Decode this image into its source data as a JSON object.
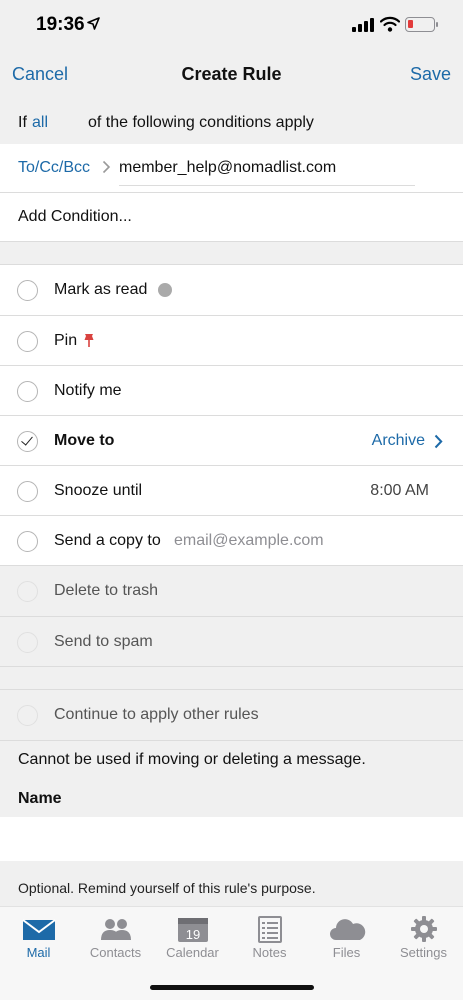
{
  "status_bar": {
    "time": "19:36",
    "icons": [
      "location-arrow-icon",
      "cellular-signal-icon",
      "wifi-icon",
      "battery-low-icon"
    ],
    "battery_color": "#e23b3b"
  },
  "nav": {
    "cancel_label": "Cancel",
    "title": "Create Rule",
    "save_label": "Save"
  },
  "conditions": {
    "prefix": "If",
    "match_mode": "all",
    "suffix": "of the following conditions apply",
    "items": [
      {
        "field": "To/Cc/Bcc",
        "value": "member_help@nomadlist.com"
      }
    ],
    "add_label": "Add Condition..."
  },
  "actions": [
    {
      "label": "Mark as read",
      "checked": false,
      "enabled": true
    },
    {
      "label": "Pin",
      "checked": false,
      "enabled": true
    },
    {
      "label": "Notify me",
      "checked": false,
      "enabled": true
    },
    {
      "label": "Move to",
      "checked": true,
      "enabled": true,
      "value": "Archive"
    },
    {
      "label": "Snooze until",
      "checked": false,
      "enabled": true,
      "value": "8:00 AM"
    },
    {
      "label": "Send a copy to",
      "checked": false,
      "enabled": true,
      "placeholder": "email@example.com"
    },
    {
      "label": "Delete to trash",
      "checked": false,
      "enabled": false
    },
    {
      "label": "Send to spam",
      "checked": false,
      "enabled": false
    }
  ],
  "continue_rule": {
    "label": "Continue to apply other rules",
    "enabled": false,
    "note": "Cannot be used if moving or deleting a message."
  },
  "name_section": {
    "label": "Name",
    "value": "",
    "hint": "Optional. Remind yourself of this rule's purpose."
  },
  "tabbar": {
    "active": "Mail",
    "accent": "#1d6aa8",
    "items": [
      {
        "label": "Mail",
        "icon": "mail-icon"
      },
      {
        "label": "Contacts",
        "icon": "contacts-icon"
      },
      {
        "label": "Calendar",
        "icon": "calendar-icon",
        "badge": "19"
      },
      {
        "label": "Notes",
        "icon": "notes-icon"
      },
      {
        "label": "Files",
        "icon": "files-cloud-icon"
      },
      {
        "label": "Settings",
        "icon": "gear-icon"
      }
    ]
  }
}
